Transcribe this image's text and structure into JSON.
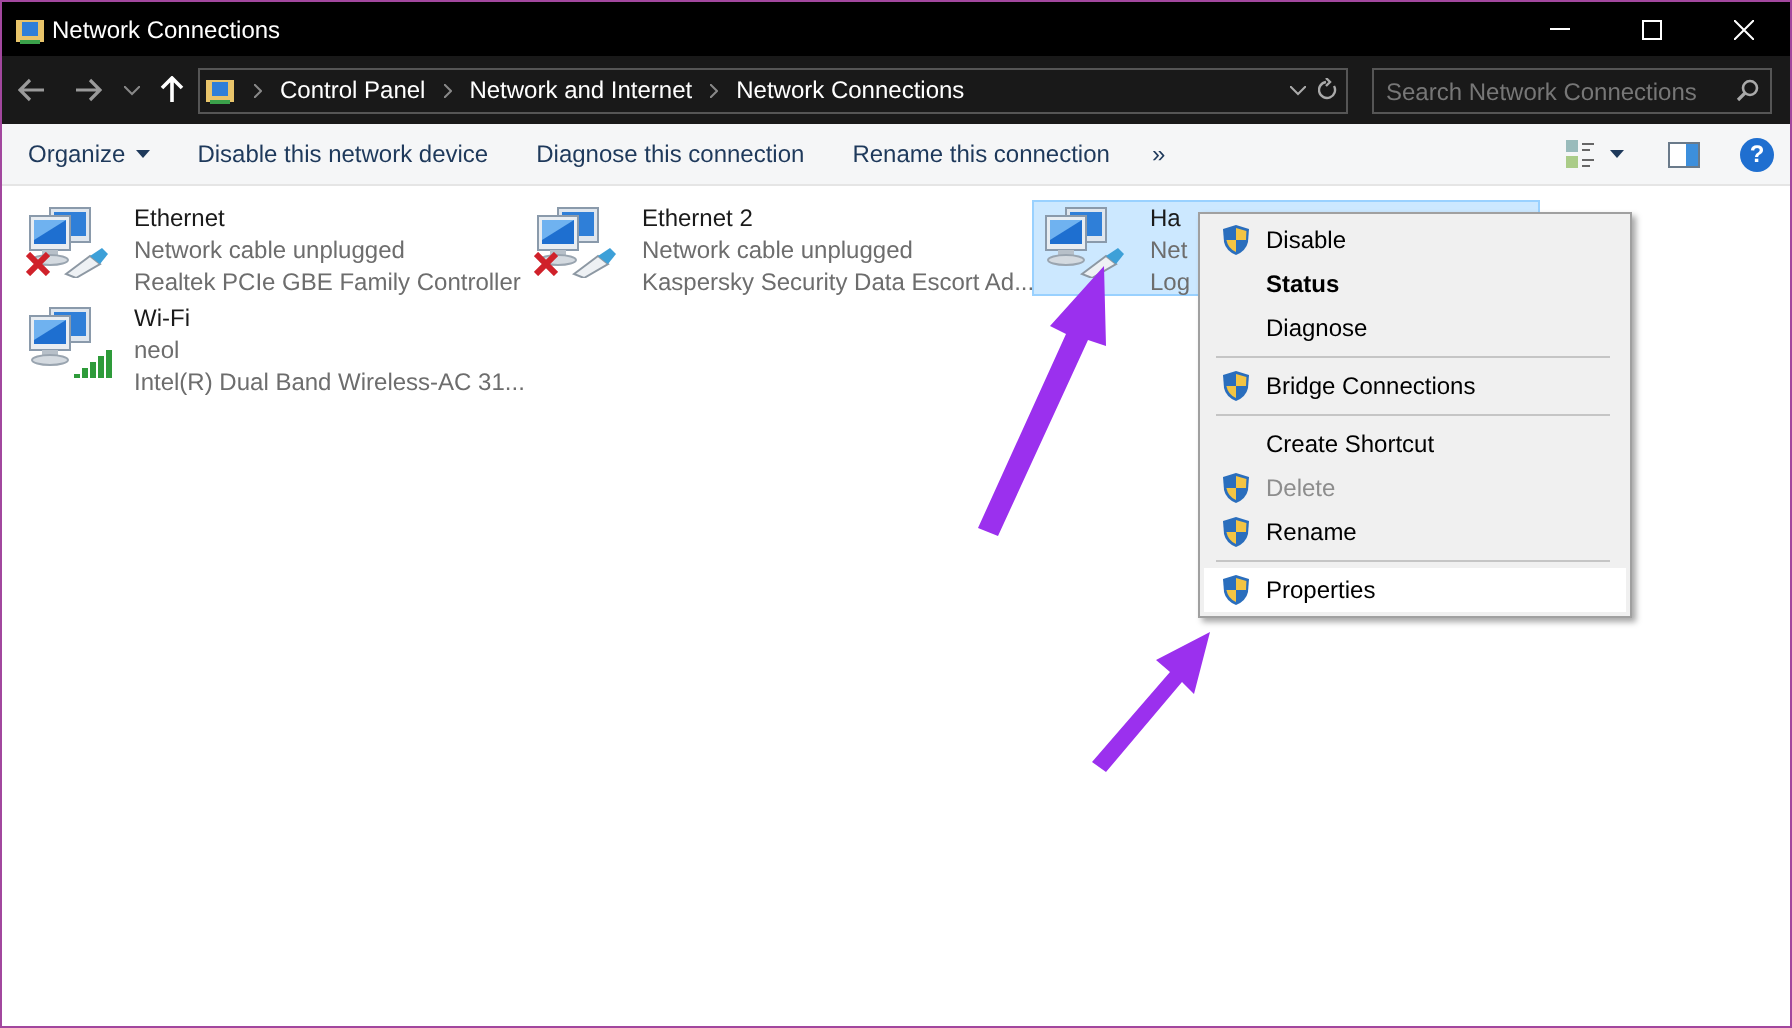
{
  "window": {
    "title": "Network Connections"
  },
  "address_bar": {
    "breadcrumbs": [
      "Control Panel",
      "Network and Internet",
      "Network Connections"
    ]
  },
  "search": {
    "placeholder": "Search Network Connections"
  },
  "toolbar": {
    "commands": [
      {
        "label": "Organize",
        "kind": "menu"
      },
      {
        "label": "Disable this network device",
        "kind": "command"
      },
      {
        "label": "Diagnose this connection",
        "kind": "command"
      },
      {
        "label": "Rename this connection",
        "kind": "command"
      }
    ],
    "more": "»",
    "help": "?"
  },
  "connections": [
    {
      "name": "Ethernet",
      "status": "Network cable unplugged",
      "device": "Realtek PCIe GBE Family Controller",
      "kind": "wired",
      "disconnected": true,
      "selected": false
    },
    {
      "name": "Ethernet 2",
      "status": "Network cable unplugged",
      "device": "Kaspersky Security Data Escort Ad...",
      "kind": "wired",
      "disconnected": true,
      "selected": false
    },
    {
      "name": "Ha",
      "status": "Net",
      "device": "Log",
      "kind": "wired",
      "disconnected": false,
      "selected": true
    },
    {
      "name": "Wi-Fi",
      "status": "neol",
      "device": "Intel(R) Dual Band Wireless-AC 31...",
      "kind": "wireless",
      "disconnected": false,
      "selected": false
    }
  ],
  "context_menu": [
    {
      "kind": "item",
      "label": "Disable",
      "shield": true,
      "bold": false,
      "disabled": false,
      "selected": false
    },
    {
      "kind": "item",
      "label": "Status",
      "shield": false,
      "bold": true,
      "disabled": false,
      "selected": false
    },
    {
      "kind": "item",
      "label": "Diagnose",
      "shield": false,
      "bold": false,
      "disabled": false,
      "selected": false
    },
    {
      "kind": "separator"
    },
    {
      "kind": "item",
      "label": "Bridge Connections",
      "shield": true,
      "bold": false,
      "disabled": false,
      "selected": false
    },
    {
      "kind": "separator"
    },
    {
      "kind": "item",
      "label": "Create Shortcut",
      "shield": false,
      "bold": false,
      "disabled": false,
      "selected": false
    },
    {
      "kind": "item",
      "label": "Delete",
      "shield": true,
      "bold": false,
      "disabled": true,
      "selected": false
    },
    {
      "kind": "item",
      "label": "Rename",
      "shield": true,
      "bold": false,
      "disabled": false,
      "selected": false
    },
    {
      "kind": "separator"
    },
    {
      "kind": "item",
      "label": "Properties",
      "shield": true,
      "bold": false,
      "disabled": false,
      "selected": true
    }
  ]
}
